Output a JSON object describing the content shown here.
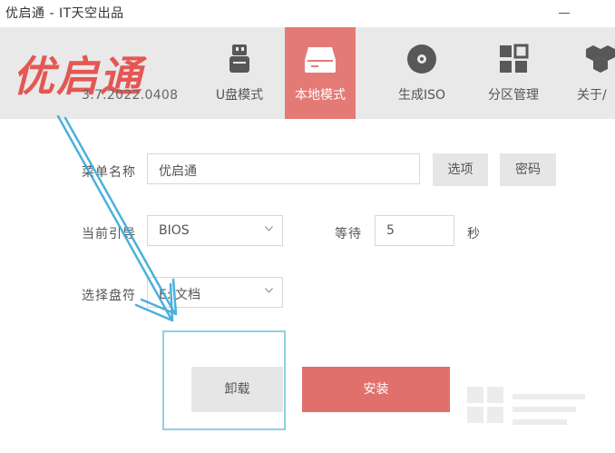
{
  "window": {
    "title": "优启通 - IT天空出品"
  },
  "app": {
    "logo_text": "优启通",
    "version": "3.7.2022.0408"
  },
  "tabs": [
    {
      "label": "U盘模式",
      "icon": "usb-drive-icon",
      "active": false
    },
    {
      "label": "本地模式",
      "icon": "hard-drive-icon",
      "active": true
    },
    {
      "label": "生成ISO",
      "icon": "disc-icon",
      "active": false
    },
    {
      "label": "分区管理",
      "icon": "partition-grid-icon",
      "active": false
    },
    {
      "label": "关于/",
      "icon": "about-icon",
      "active": false
    }
  ],
  "form": {
    "menu_name_label": "菜单名称",
    "menu_name_value": "优启通",
    "options_button": "选项",
    "password_button": "密码",
    "boot_label": "当前引导",
    "boot_value": "BIOS",
    "wait_label": "等待",
    "wait_value": "5",
    "wait_unit": "秒",
    "drive_label": "选择盘符",
    "drive_value": "E: 文档"
  },
  "actions": {
    "uninstall_label": "卸载",
    "install_label": "安装"
  },
  "colors": {
    "brand_red": "#e45752",
    "active_tab": "#e47a76",
    "install_button": "#e0706b",
    "annotation_blue": "#3aa8d8"
  }
}
